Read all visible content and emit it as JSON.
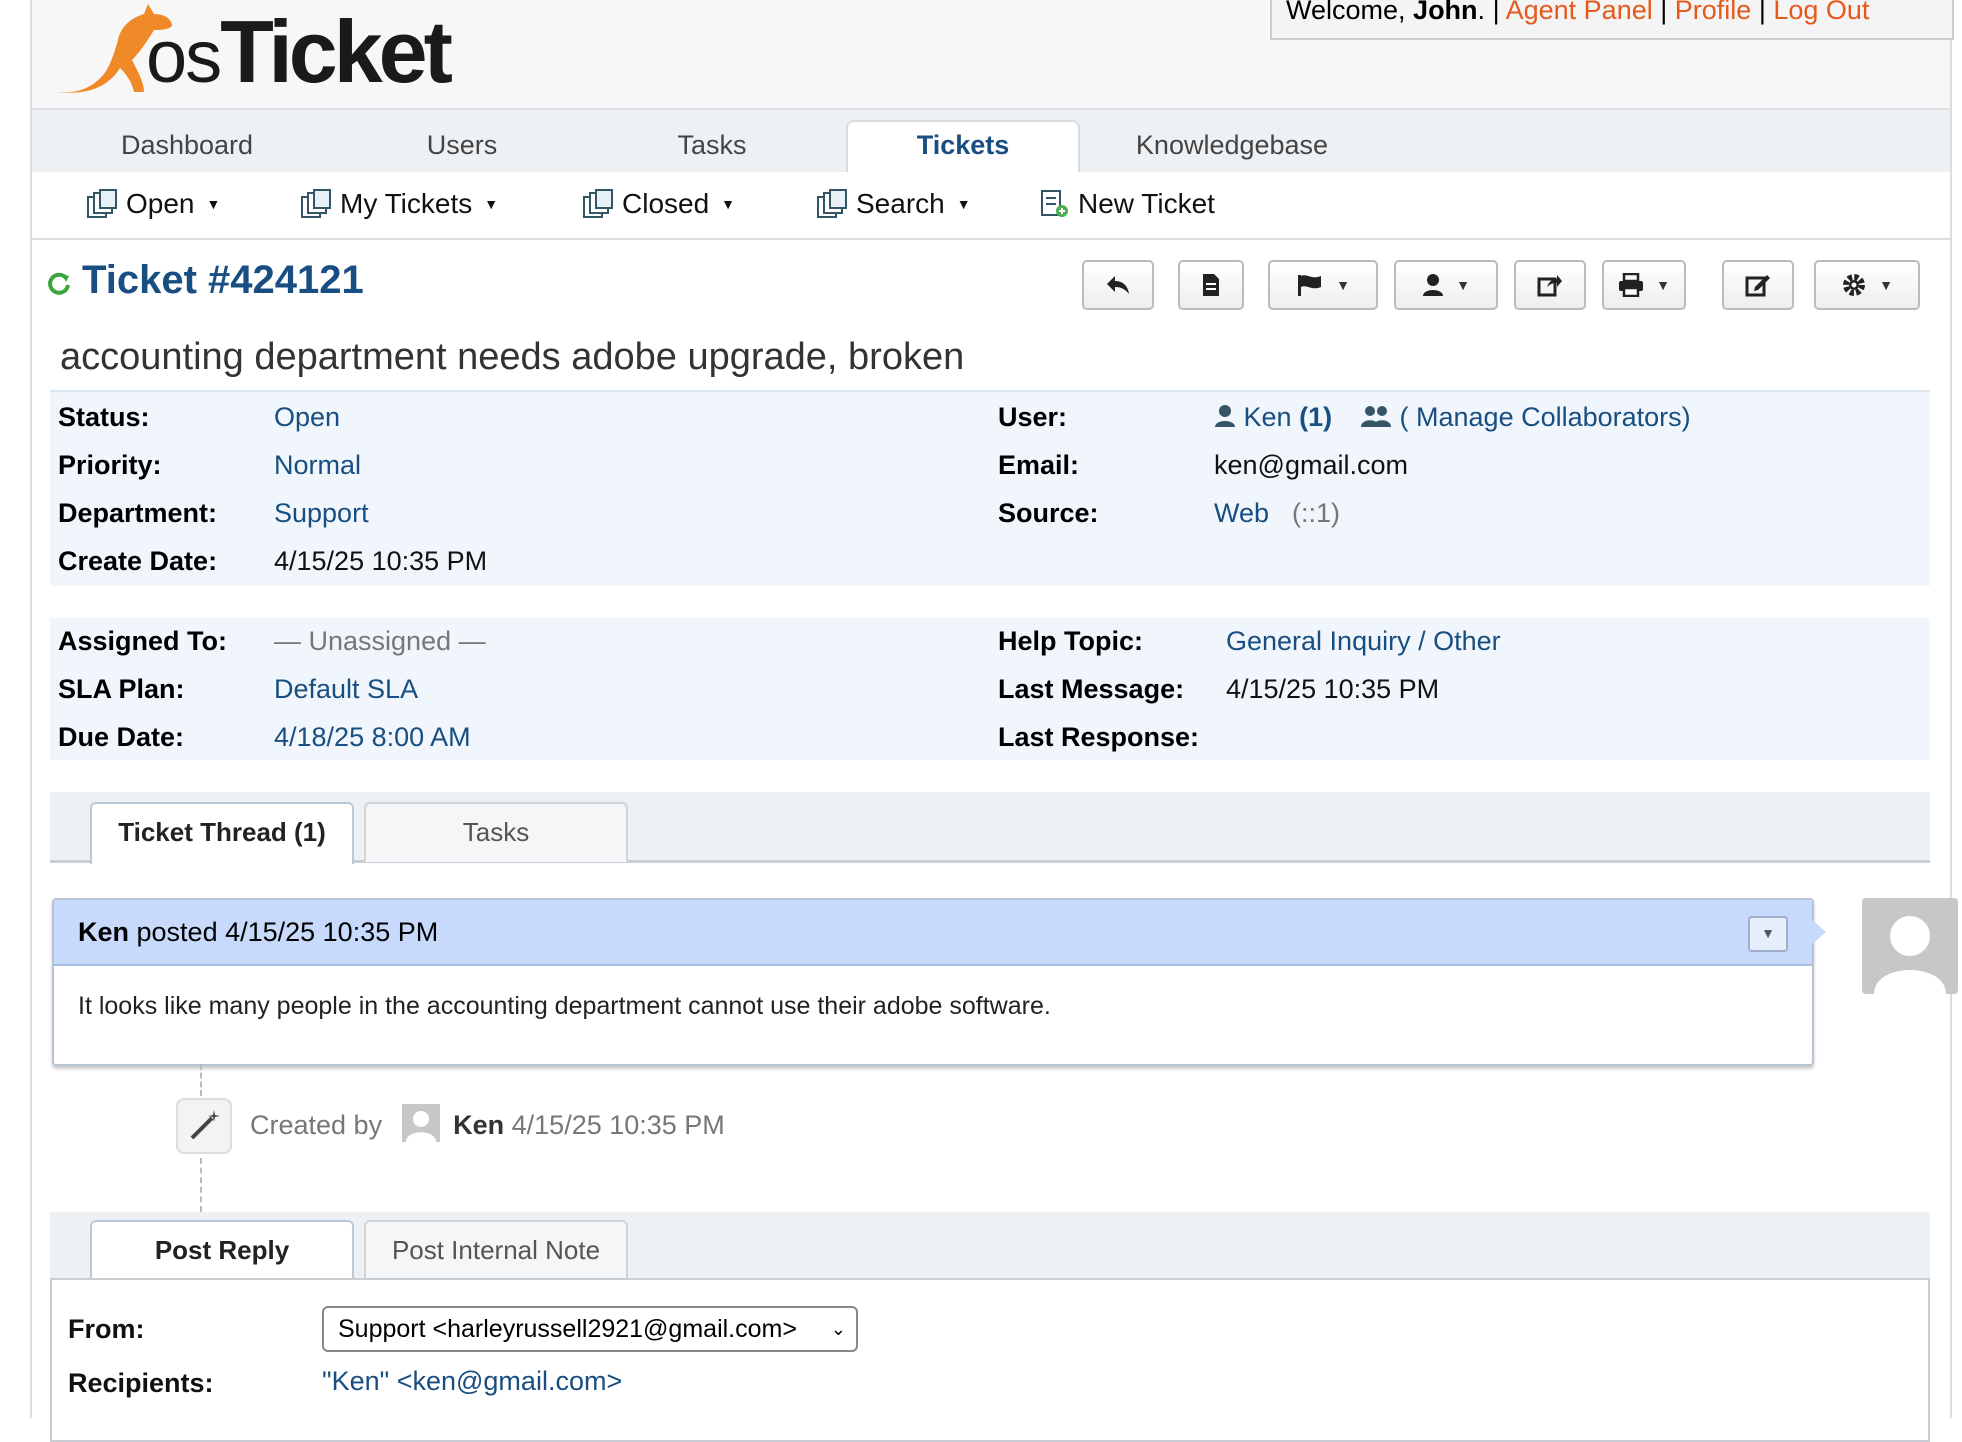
{
  "brand": {
    "logo_text": "osTicket",
    "logo_prefix": "os",
    "logo_suffix": "Ticket"
  },
  "user_bar": {
    "welcome": "Welcome, ",
    "user": "John",
    "period": ".",
    "sep": "|",
    "agent_panel": "Agent Panel",
    "profile": "Profile",
    "logout": "Log Out"
  },
  "nav": {
    "tabs": [
      "Dashboard",
      "Users",
      "Tasks",
      "Tickets",
      "Knowledgebase"
    ],
    "active": "Tickets"
  },
  "subnav": {
    "open": "Open",
    "my_tickets": "My Tickets",
    "closed": "Closed",
    "search": "Search",
    "new_ticket": "New Ticket"
  },
  "ticket": {
    "title": "Ticket #424121",
    "subject": "accounting department needs adobe upgrade, broken",
    "status_label": "Status:",
    "status": "Open",
    "priority_label": "Priority:",
    "priority": "Normal",
    "department_label": "Department:",
    "department": "Support",
    "create_date_label": "Create Date:",
    "create_date": "4/15/25 10:35 PM",
    "user_label": "User:",
    "user": "Ken",
    "user_count": "(1)",
    "collaborators": "( Manage Collaborators)",
    "email_label": "Email:",
    "email": "ken@gmail.com",
    "source_label": "Source:",
    "source": "Web",
    "source_ip": "(::1)",
    "assigned_label": "Assigned To:",
    "assigned": "— Unassigned —",
    "sla_label": "SLA Plan:",
    "sla": "Default SLA",
    "due_label": "Due Date:",
    "due": "4/18/25 8:00 AM",
    "help_topic_label": "Help Topic:",
    "help_topic": "General Inquiry / Other",
    "last_message_label": "Last Message:",
    "last_message": "4/15/25 10:35 PM",
    "last_response_label": "Last Response:",
    "last_response": ""
  },
  "thread_tabs": {
    "thread": "Ticket Thread (1)",
    "tasks": "Tasks"
  },
  "message": {
    "author": "Ken",
    "posted": " posted 4/15/25 10:35 PM",
    "body": "It looks like many people in the accounting department cannot use their adobe software."
  },
  "event": {
    "created_by": "Created by",
    "author": "Ken",
    "time": "4/15/25 10:35 PM"
  },
  "reply_tabs": {
    "post_reply": "Post Reply",
    "internal_note": "Post Internal Note"
  },
  "reply_form": {
    "from_label": "From:",
    "from_value": "Support <harleyrussell2921@gmail.com>",
    "recipients_label": "Recipients:",
    "recipients_value": "\"Ken\" <ken@gmail.com>"
  },
  "colors": {
    "link": "#184e81",
    "accent": "#e35a1b",
    "thread_header": "#c8dafc",
    "info_bg": "#f0f6fb"
  }
}
